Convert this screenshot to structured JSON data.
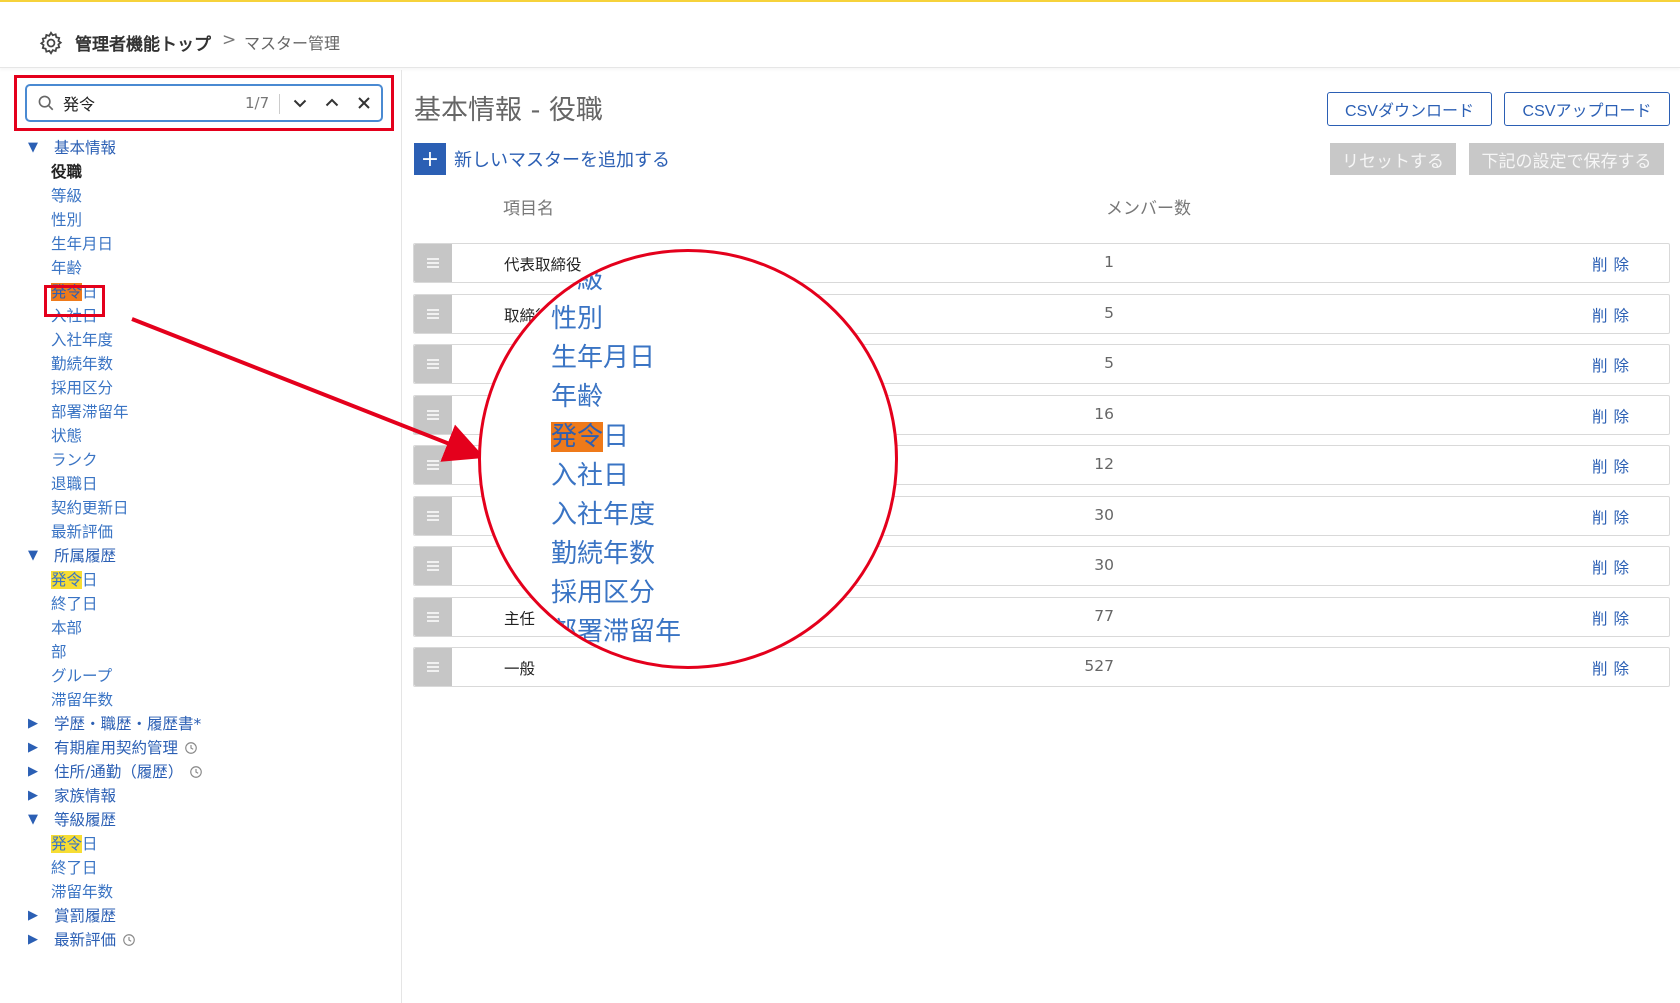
{
  "breadcrumb": {
    "home": "管理者機能トップ",
    "separator": ">",
    "current": "マスター管理"
  },
  "search": {
    "value": "発令",
    "count": "1/7",
    "icons": [
      "search-icon",
      "chevron-down-icon",
      "chevron-up-icon",
      "close-icon"
    ]
  },
  "sidebar": {
    "group1": {
      "arrow": "▼",
      "label": "基本情報"
    },
    "group1_items": [
      {
        "label": "役職"
      },
      {
        "label": "等級"
      },
      {
        "label": "性別"
      },
      {
        "label": "生年月日"
      },
      {
        "label": "年齢"
      },
      {
        "hl": "発令",
        "rest": "日"
      },
      {
        "label": "入社日"
      },
      {
        "label": "入社年度"
      },
      {
        "label": "勤続年数"
      },
      {
        "label": "採用区分"
      },
      {
        "label": "部署滞留年"
      },
      {
        "label": "状態"
      },
      {
        "label": "ランク"
      },
      {
        "label": "退職日"
      },
      {
        "label": "契約更新日"
      },
      {
        "label": "最新評価"
      }
    ],
    "group2": {
      "arrow": "▼",
      "label": "所属履歴"
    },
    "group2_items": [
      {
        "hl": "発令",
        "rest": "日"
      },
      {
        "label": "終了日"
      },
      {
        "label": "本部"
      },
      {
        "label": "部"
      },
      {
        "label": "グループ"
      },
      {
        "label": "滞留年数"
      }
    ],
    "group3": {
      "arrow": "▶",
      "label": "学歴・職歴・履歴書*"
    },
    "group4": {
      "arrow": "▶",
      "label": "有期雇用契約管理"
    },
    "group5": {
      "arrow": "▶",
      "label": "住所/通勤（履歴）"
    },
    "group6": {
      "arrow": "▶",
      "label": "家族情報"
    },
    "group7": {
      "arrow": "▼",
      "label": "等級履歴"
    },
    "group7_items": [
      {
        "hl": "発令",
        "rest": "日"
      },
      {
        "label": "終了日"
      },
      {
        "label": "滞留年数"
      }
    ],
    "group8": {
      "arrow": "▶",
      "label": "賞罰履歴"
    },
    "group9": {
      "arrow": "▶",
      "label": "最新評価"
    }
  },
  "main": {
    "title": "基本情報 - 役職",
    "csv_download": "CSVダウンロード",
    "csv_upload": "CSVアップロード",
    "add_label": "新しいマスターを追加する",
    "add_plus": "+",
    "reset_label": "リセットする",
    "save_label": "下記の設定で保存する",
    "col_name": "項目名",
    "col_members": "メンバー数",
    "rows": [
      {
        "name": "代表取締役",
        "count": "1",
        "del": "削除"
      },
      {
        "name": "取締役",
        "count": "5",
        "del": "削除"
      },
      {
        "name": "",
        "count": "5",
        "del": "削除"
      },
      {
        "name": "",
        "count": "16",
        "del": "削除"
      },
      {
        "name": "",
        "count": "12",
        "del": "削除"
      },
      {
        "name": "",
        "count": "30",
        "del": "削除"
      },
      {
        "name": "",
        "count": "30",
        "del": "削除"
      },
      {
        "name": "主任",
        "count": "77",
        "del": "削除"
      },
      {
        "name": "一般",
        "count": "527",
        "del": "削除"
      }
    ]
  },
  "magnifier": {
    "items": [
      {
        "label": "等級"
      },
      {
        "label": "性別"
      },
      {
        "label": "生年月日"
      },
      {
        "label": "年齢"
      },
      {
        "hl": "発令",
        "rest": "日"
      },
      {
        "label": "入社日"
      },
      {
        "label": "入社年度"
      },
      {
        "label": "勤続年数"
      },
      {
        "label": "採用区分"
      },
      {
        "label": "部署滞留年"
      }
    ]
  },
  "colors": {
    "accent": "#2b5fb4",
    "link": "#3a74c4",
    "highlight_yellow": "#f7dd33",
    "highlight_orange": "#ef7a1a",
    "annotation_red": "#e4001c",
    "header_line": "#f6d23b"
  }
}
